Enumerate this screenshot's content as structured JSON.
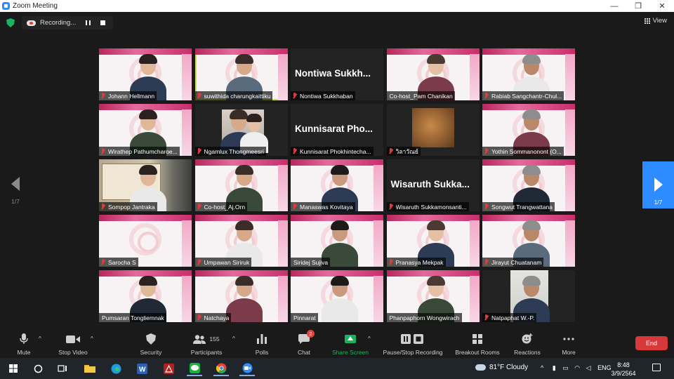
{
  "window": {
    "title": "Zoom Meeting",
    "controls": {
      "minimize": "—",
      "restore": "❐",
      "close": "✕"
    }
  },
  "meeting": {
    "recording_label": "Recording...",
    "view_label": "View",
    "page_indicator_left": "1/7",
    "page_indicator_right": "1/7"
  },
  "participants": [
    {
      "name": "Johann Hellmann",
      "bg": "slide",
      "muted": true
    },
    {
      "name": "suwithida charungkaittiku",
      "bg": "slide",
      "muted": true,
      "active": true
    },
    {
      "name": "Nontiwa Sukkhaban",
      "bg": "dark",
      "muted": true,
      "bigname": "Nontiwa  Sukkh..."
    },
    {
      "name": "Co-host_Pam Chanikan",
      "bg": "slide",
      "muted": false
    },
    {
      "name": "Rabiab Sangchantr-Chul...",
      "bg": "slide",
      "muted": true
    },
    {
      "name": "Wirathep Pathumcharoe...",
      "bg": "slide",
      "muted": true
    },
    {
      "name": "Ngamlux Thongmeesri",
      "bg": "dark",
      "muted": true
    },
    {
      "name": "Kunnisarat Phokhintecha...",
      "bg": "dark",
      "muted": true,
      "bigname": "Kunnisarat  Pho..."
    },
    {
      "name": "วิลาวัณย์",
      "bg": "dark",
      "muted": true
    },
    {
      "name": "Yothin Sommanonont (O...",
      "bg": "slide",
      "muted": true
    },
    {
      "name": "Sompop Jantraka",
      "bg": "photo",
      "muted": true
    },
    {
      "name": "Co-host_Aj.Orn",
      "bg": "slide",
      "muted": true
    },
    {
      "name": "Manaswas Kovitaya",
      "bg": "slide",
      "muted": true
    },
    {
      "name": "Wisaruth Sukkamonsanti...",
      "bg": "dark",
      "muted": true,
      "bigname": "Wisaruth  Sukka..."
    },
    {
      "name": "Songwut Trangwattana",
      "bg": "slide",
      "muted": true
    },
    {
      "name": "Sarocha S",
      "bg": "slide",
      "muted": true
    },
    {
      "name": "Umpawan Siriruk",
      "bg": "slide",
      "muted": true
    },
    {
      "name": "Siridej Sujiva",
      "bg": "slide",
      "muted": false
    },
    {
      "name": "Pranasya Mekpak",
      "bg": "slide",
      "muted": true
    },
    {
      "name": "Jirayut  Chuatanam",
      "bg": "slide",
      "muted": true
    },
    {
      "name": "Pumsaran Tongliemnak",
      "bg": "slide",
      "muted": false
    },
    {
      "name": "Natchaya",
      "bg": "slide",
      "muted": true
    },
    {
      "name": "Pinnarat",
      "bg": "slide",
      "muted": false
    },
    {
      "name": "Phanpaphorn Wongwirach",
      "bg": "slide",
      "muted": false
    },
    {
      "name": "Natpaphat W.-P.",
      "bg": "dark",
      "muted": true
    }
  ],
  "toolbar": {
    "mute": "Mute",
    "stop_video": "Stop Video",
    "security": "Security",
    "participants": "Participants",
    "participants_count": "155",
    "polls": "Polls",
    "chat": "Chat",
    "chat_badge": "2",
    "share_screen": "Share Screen",
    "pause_recording": "Pause/Stop Recording",
    "breakout": "Breakout Rooms",
    "reactions": "Reactions",
    "more": "More",
    "end": "End"
  },
  "taskbar": {
    "weather": "81°F  Cloudy",
    "lang": "ENG",
    "time": "8:48",
    "date": "3/9/2564"
  },
  "colors": {
    "accent": "#2d8cff",
    "share_green": "#1bb45e",
    "end_red": "#d7383a",
    "active_speaker": "#c6e34b"
  }
}
